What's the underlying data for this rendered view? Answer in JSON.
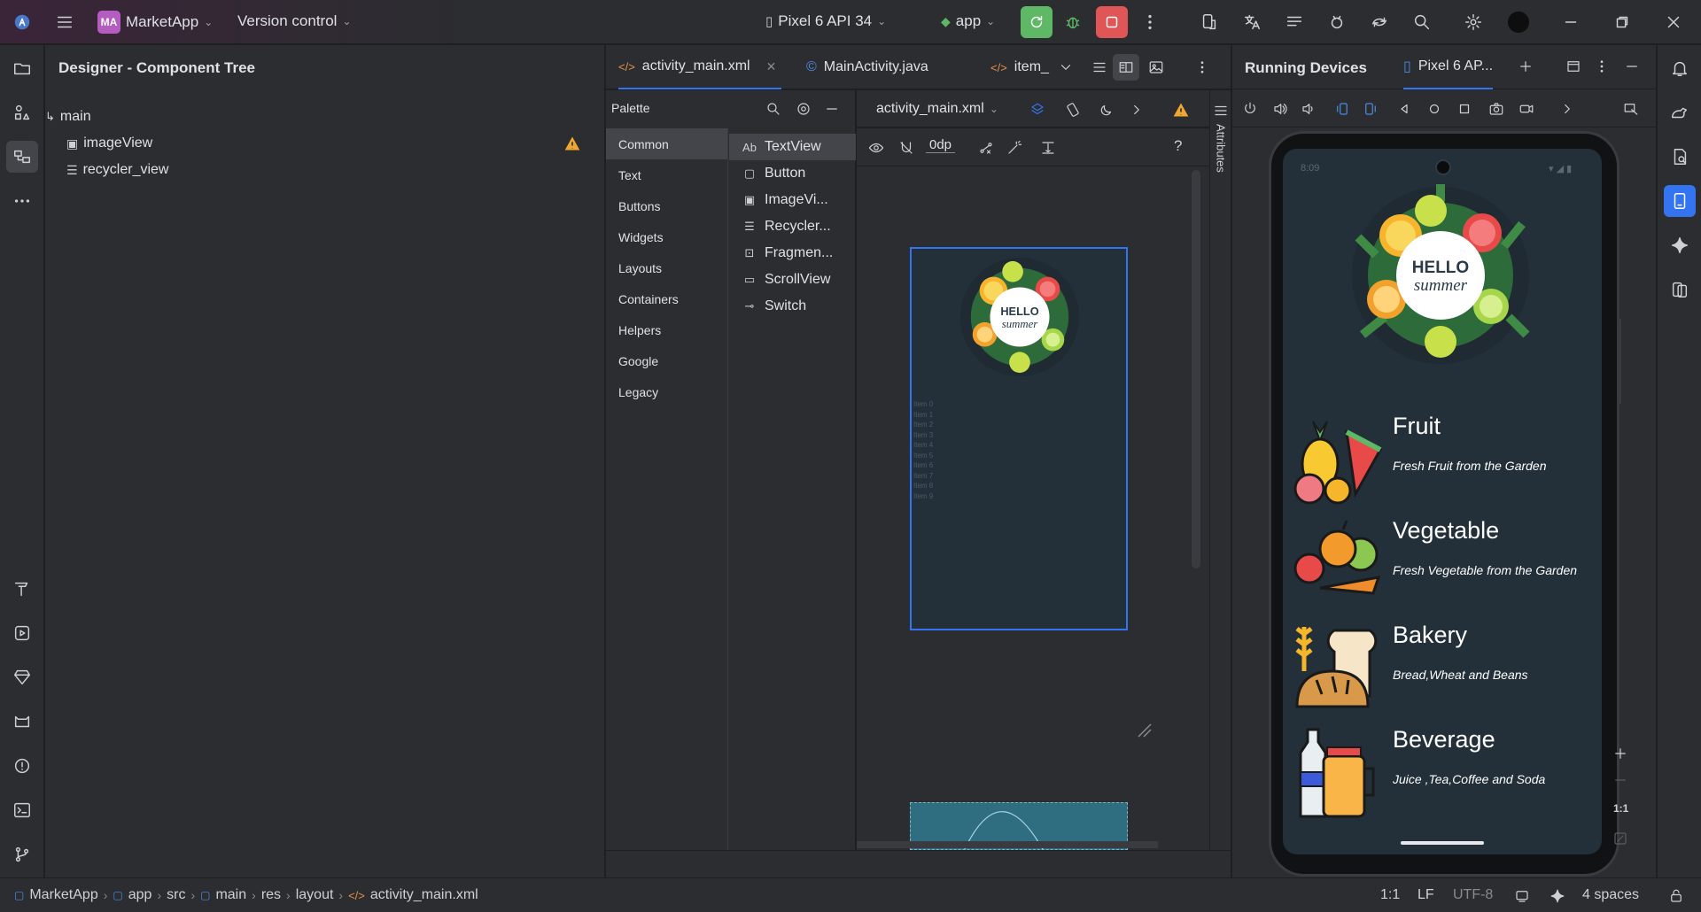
{
  "titlebar": {
    "project_badge": "MA",
    "project_name": "MarketApp",
    "vcs": "Version control",
    "device": "Pixel 6 API 34",
    "run_config": "app"
  },
  "tree": {
    "title": "Designer - Component Tree",
    "root": "main",
    "items": [
      "imageView",
      "recycler_view"
    ]
  },
  "tabs": {
    "items": [
      "activity_main.xml",
      "MainActivity.java",
      "item_"
    ]
  },
  "palette": {
    "title": "Palette",
    "categories": [
      "Common",
      "Text",
      "Buttons",
      "Widgets",
      "Layouts",
      "Containers",
      "Helpers",
      "Google",
      "Legacy"
    ],
    "items": [
      {
        "glyph": "Ab",
        "label": "TextView"
      },
      {
        "glyph": "▢",
        "label": "Button"
      },
      {
        "glyph": "▣",
        "label": "ImageVi..."
      },
      {
        "glyph": "☰",
        "label": "Recycler..."
      },
      {
        "glyph": "⊡",
        "label": "Fragmen..."
      },
      {
        "glyph": "▭",
        "label": "ScrollView"
      },
      {
        "glyph": "⊸",
        "label": "Switch"
      }
    ]
  },
  "design": {
    "file": "activity_main.xml",
    "margin": "0dp",
    "attributes_label": "Attributes",
    "hello": "HELLO",
    "summer": "summer",
    "preview_items": [
      "Item 0",
      "Item 1",
      "Item 2",
      "Item 3",
      "Item 4",
      "Item 5",
      "Item 6",
      "Item 7",
      "Item 8",
      "Item 9"
    ]
  },
  "devices": {
    "title": "Running Devices",
    "tab": "Pixel 6 AP...",
    "clock": "8:09",
    "zoom_label": "1:1",
    "banner_hello": "HELLO",
    "banner_summer": "summer",
    "categories": [
      {
        "title": "Fruit",
        "subtitle": "Fresh Fruit from the Garden"
      },
      {
        "title": "Vegetable",
        "subtitle": "Fresh Vegetable from the Garden"
      },
      {
        "title": "Bakery",
        "subtitle": "Bread,Wheat and Beans"
      },
      {
        "title": "Beverage",
        "subtitle": "Juice ,Tea,Coffee and Soda"
      }
    ]
  },
  "statusbar": {
    "crumbs": [
      "MarketApp",
      "app",
      "src",
      "main",
      "res",
      "layout",
      "activity_main.xml"
    ],
    "position": "1:1",
    "line_sep": "LF",
    "encoding": "UTF-8",
    "indent": "4 spaces"
  },
  "colors": {
    "accent": "#3574f0",
    "run_green": "#5fb865",
    "stop_red": "#e05555",
    "warning": "#f0a732",
    "phone_bg": "#233039"
  }
}
